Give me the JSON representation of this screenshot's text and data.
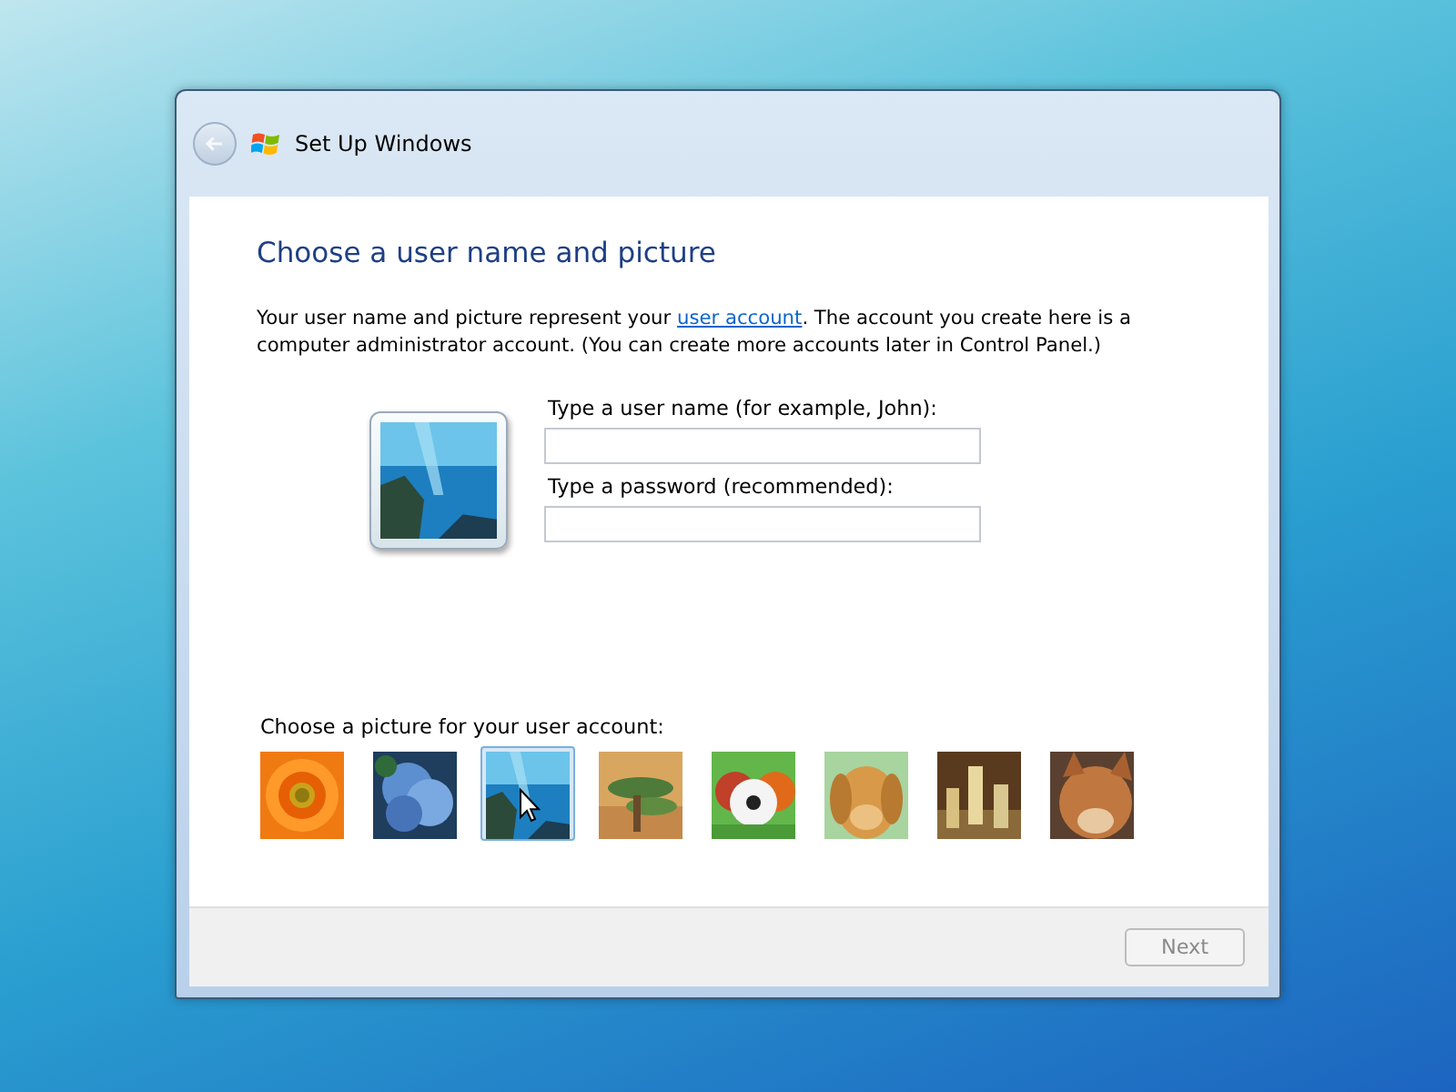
{
  "window": {
    "title": "Set Up Windows",
    "back_enabled": false
  },
  "heading": "Choose a user name and picture",
  "intro": {
    "before": "Your user name and picture represent your ",
    "link": "user account",
    "after": ". The account you create here is a computer administrator account. (You can create more accounts later in Control Panel.)"
  },
  "fields": [
    {
      "label": "Type a user name (for example, John):"
    },
    {
      "label": "Type a password (recommended):"
    }
  ],
  "picture_prompt": "Choose a picture for your user account:",
  "pictures": [
    {
      "kind": "picture",
      "selected": false
    },
    {
      "kind": "picture",
      "selected": false
    },
    {
      "kind": "picture",
      "selected": true
    },
    {
      "kind": "picture",
      "selected": false
    },
    {
      "kind": "picture",
      "selected": false
    },
    {
      "kind": "picture",
      "selected": false
    },
    {
      "kind": "picture",
      "selected": false
    },
    {
      "kind": "picture",
      "selected": false
    }
  ],
  "next_button": {
    "label": "Next",
    "disabled": true
  }
}
